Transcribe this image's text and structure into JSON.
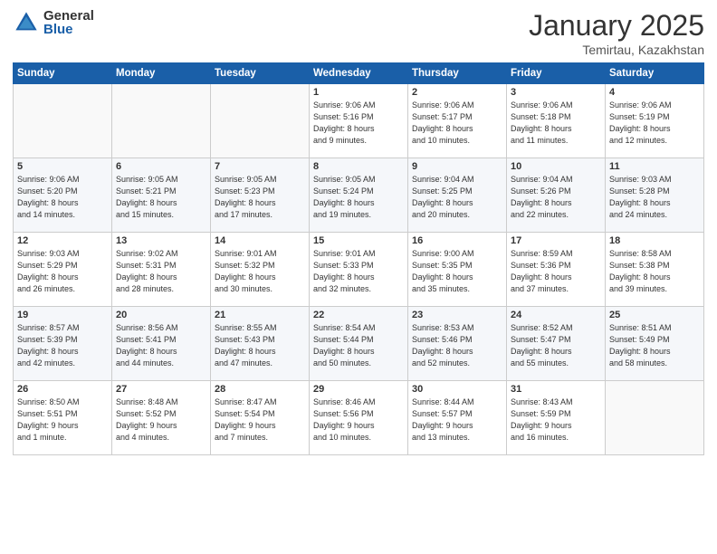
{
  "header": {
    "logo_general": "General",
    "logo_blue": "Blue",
    "title": "January 2025",
    "subtitle": "Temirtau, Kazakhstan"
  },
  "days_of_week": [
    "Sunday",
    "Monday",
    "Tuesday",
    "Wednesday",
    "Thursday",
    "Friday",
    "Saturday"
  ],
  "weeks": [
    [
      {
        "num": "",
        "info": ""
      },
      {
        "num": "",
        "info": ""
      },
      {
        "num": "",
        "info": ""
      },
      {
        "num": "1",
        "info": "Sunrise: 9:06 AM\nSunset: 5:16 PM\nDaylight: 8 hours\nand 9 minutes."
      },
      {
        "num": "2",
        "info": "Sunrise: 9:06 AM\nSunset: 5:17 PM\nDaylight: 8 hours\nand 10 minutes."
      },
      {
        "num": "3",
        "info": "Sunrise: 9:06 AM\nSunset: 5:18 PM\nDaylight: 8 hours\nand 11 minutes."
      },
      {
        "num": "4",
        "info": "Sunrise: 9:06 AM\nSunset: 5:19 PM\nDaylight: 8 hours\nand 12 minutes."
      }
    ],
    [
      {
        "num": "5",
        "info": "Sunrise: 9:06 AM\nSunset: 5:20 PM\nDaylight: 8 hours\nand 14 minutes."
      },
      {
        "num": "6",
        "info": "Sunrise: 9:05 AM\nSunset: 5:21 PM\nDaylight: 8 hours\nand 15 minutes."
      },
      {
        "num": "7",
        "info": "Sunrise: 9:05 AM\nSunset: 5:23 PM\nDaylight: 8 hours\nand 17 minutes."
      },
      {
        "num": "8",
        "info": "Sunrise: 9:05 AM\nSunset: 5:24 PM\nDaylight: 8 hours\nand 19 minutes."
      },
      {
        "num": "9",
        "info": "Sunrise: 9:04 AM\nSunset: 5:25 PM\nDaylight: 8 hours\nand 20 minutes."
      },
      {
        "num": "10",
        "info": "Sunrise: 9:04 AM\nSunset: 5:26 PM\nDaylight: 8 hours\nand 22 minutes."
      },
      {
        "num": "11",
        "info": "Sunrise: 9:03 AM\nSunset: 5:28 PM\nDaylight: 8 hours\nand 24 minutes."
      }
    ],
    [
      {
        "num": "12",
        "info": "Sunrise: 9:03 AM\nSunset: 5:29 PM\nDaylight: 8 hours\nand 26 minutes."
      },
      {
        "num": "13",
        "info": "Sunrise: 9:02 AM\nSunset: 5:31 PM\nDaylight: 8 hours\nand 28 minutes."
      },
      {
        "num": "14",
        "info": "Sunrise: 9:01 AM\nSunset: 5:32 PM\nDaylight: 8 hours\nand 30 minutes."
      },
      {
        "num": "15",
        "info": "Sunrise: 9:01 AM\nSunset: 5:33 PM\nDaylight: 8 hours\nand 32 minutes."
      },
      {
        "num": "16",
        "info": "Sunrise: 9:00 AM\nSunset: 5:35 PM\nDaylight: 8 hours\nand 35 minutes."
      },
      {
        "num": "17",
        "info": "Sunrise: 8:59 AM\nSunset: 5:36 PM\nDaylight: 8 hours\nand 37 minutes."
      },
      {
        "num": "18",
        "info": "Sunrise: 8:58 AM\nSunset: 5:38 PM\nDaylight: 8 hours\nand 39 minutes."
      }
    ],
    [
      {
        "num": "19",
        "info": "Sunrise: 8:57 AM\nSunset: 5:39 PM\nDaylight: 8 hours\nand 42 minutes."
      },
      {
        "num": "20",
        "info": "Sunrise: 8:56 AM\nSunset: 5:41 PM\nDaylight: 8 hours\nand 44 minutes."
      },
      {
        "num": "21",
        "info": "Sunrise: 8:55 AM\nSunset: 5:43 PM\nDaylight: 8 hours\nand 47 minutes."
      },
      {
        "num": "22",
        "info": "Sunrise: 8:54 AM\nSunset: 5:44 PM\nDaylight: 8 hours\nand 50 minutes."
      },
      {
        "num": "23",
        "info": "Sunrise: 8:53 AM\nSunset: 5:46 PM\nDaylight: 8 hours\nand 52 minutes."
      },
      {
        "num": "24",
        "info": "Sunrise: 8:52 AM\nSunset: 5:47 PM\nDaylight: 8 hours\nand 55 minutes."
      },
      {
        "num": "25",
        "info": "Sunrise: 8:51 AM\nSunset: 5:49 PM\nDaylight: 8 hours\nand 58 minutes."
      }
    ],
    [
      {
        "num": "26",
        "info": "Sunrise: 8:50 AM\nSunset: 5:51 PM\nDaylight: 9 hours\nand 1 minute."
      },
      {
        "num": "27",
        "info": "Sunrise: 8:48 AM\nSunset: 5:52 PM\nDaylight: 9 hours\nand 4 minutes."
      },
      {
        "num": "28",
        "info": "Sunrise: 8:47 AM\nSunset: 5:54 PM\nDaylight: 9 hours\nand 7 minutes."
      },
      {
        "num": "29",
        "info": "Sunrise: 8:46 AM\nSunset: 5:56 PM\nDaylight: 9 hours\nand 10 minutes."
      },
      {
        "num": "30",
        "info": "Sunrise: 8:44 AM\nSunset: 5:57 PM\nDaylight: 9 hours\nand 13 minutes."
      },
      {
        "num": "31",
        "info": "Sunrise: 8:43 AM\nSunset: 5:59 PM\nDaylight: 9 hours\nand 16 minutes."
      },
      {
        "num": "",
        "info": ""
      }
    ]
  ]
}
